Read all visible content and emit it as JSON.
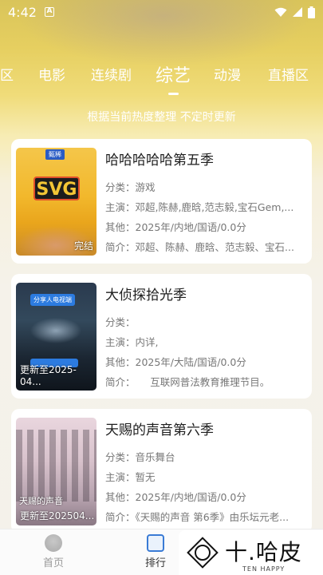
{
  "status": {
    "time": "4:42",
    "notif": "A"
  },
  "tabs": [
    {
      "label": "区"
    },
    {
      "label": "电影"
    },
    {
      "label": "连续剧"
    },
    {
      "label": "综艺",
      "active": true
    },
    {
      "label": "动漫"
    },
    {
      "label": "直播区"
    }
  ],
  "subtitle": "根据当前热度整理 不定时更新",
  "cards": [
    {
      "title": "哈哈哈哈哈第五季",
      "category": "分类：游戏",
      "cast": "主演：邓超,陈赫,鹿晗,范志毅,宝石Gem,...",
      "other": "其他：2025年/内地/国语/0.0分",
      "intro": "简介：邓超、陈赫、鹿晗、范志毅、宝石...",
      "poster_tag": "完结",
      "poster_logo": "SVG",
      "poster_badge": "甄稀"
    },
    {
      "title": "大侦探拾光季",
      "category": "分类：",
      "cast": "主演：内详,",
      "other": "其他：2025年/大陆/国语/0.0分",
      "intro": "简介：　　互联网普法教育推理节目。",
      "poster_tag": "更新至2025-04...",
      "poster_badge": "分享人电视端"
    },
    {
      "title": "天赐的声音第六季",
      "category": "分类：音乐舞台",
      "cast": "主演：暂无",
      "other": "其他：2025年/内地/国语/0.0分",
      "intro": "简介：《天赐的声音 第6季》由乐坛元老...",
      "poster_tag": "更新至202504...",
      "poster_logo": "天赐的声音"
    }
  ],
  "nav": [
    {
      "label": "首页"
    },
    {
      "label": "排行"
    }
  ],
  "brand": {
    "title": "十.哈皮",
    "sub": "TEN HAPPY"
  },
  "colors": {
    "accent": "#e6cf60",
    "card_bg": "#ffffff",
    "text_main": "#1e1e1e",
    "text_sub": "#777777"
  }
}
